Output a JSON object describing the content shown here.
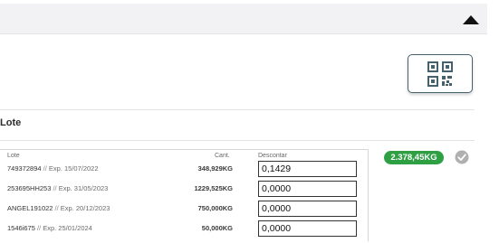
{
  "section": {
    "title": "Lote"
  },
  "table": {
    "headers": {
      "lote": "Lote",
      "cant": "Cant.",
      "descontar": "Descontar"
    },
    "rows": [
      {
        "code": "749372894",
        "separator": " // ",
        "exp": "Exp. 15/07/2022",
        "cant": "348,929KG",
        "descontar": "0,1429"
      },
      {
        "code": "253695HH253",
        "separator": " // ",
        "exp": "Exp. 31/05/2023",
        "cant": "1229,525KG",
        "descontar": "0,0000"
      },
      {
        "code": "ANGEL191022",
        "separator": " // ",
        "exp": "Exp. 20/12/2023",
        "cant": "750,000KG",
        "descontar": "0,0000"
      },
      {
        "code": "1546i675",
        "separator": " // ",
        "exp": "Exp. 25/01/2024",
        "cant": "50,000KG",
        "descontar": "0,0000"
      }
    ]
  },
  "total_badge": "2.378,45KG",
  "icons": {
    "collapse": "triangle-up-icon",
    "qr": "qr-code-icon",
    "confirm": "check-circle-icon"
  },
  "colors": {
    "badge_green": "#2ea043",
    "qr_border": "#45616e",
    "check_gray": "#b0b0b0"
  }
}
